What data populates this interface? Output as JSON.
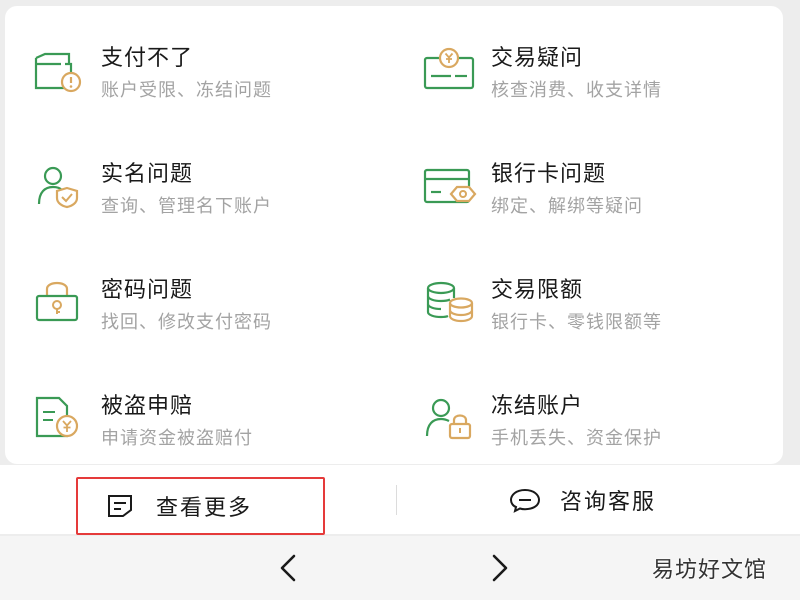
{
  "colors": {
    "accent_green": "#3a9a55",
    "accent_gold": "#d9a860",
    "highlight_red": "#e53a3a"
  },
  "items": [
    {
      "title": "支付不了",
      "subtitle": "账户受限、冻结问题",
      "icon": "wallet-alert-icon"
    },
    {
      "title": "交易疑问",
      "subtitle": "核查消费、收支详情",
      "icon": "bill-yuan-icon"
    },
    {
      "title": "实名问题",
      "subtitle": "查询、管理名下账户",
      "icon": "user-shield-icon"
    },
    {
      "title": "银行卡问题",
      "subtitle": "绑定、解绑等疑问",
      "icon": "bank-card-icon"
    },
    {
      "title": "密码问题",
      "subtitle": "找回、修改支付密码",
      "icon": "password-lock-icon"
    },
    {
      "title": "交易限额",
      "subtitle": "银行卡、零钱限额等",
      "icon": "coin-stack-icon"
    },
    {
      "title": "被盗申赔",
      "subtitle": "申请资金被盗赔付",
      "icon": "claim-document-icon"
    },
    {
      "title": "冻结账户",
      "subtitle": "手机丢失、资金保护",
      "icon": "user-lock-icon"
    }
  ],
  "bottom_bar": {
    "more_label": "查看更多",
    "contact_label": "咨询客服"
  },
  "nav": {
    "back_icon": "chevron-left-icon",
    "forward_icon": "chevron-right-icon"
  },
  "watermark": "易坊好文馆"
}
